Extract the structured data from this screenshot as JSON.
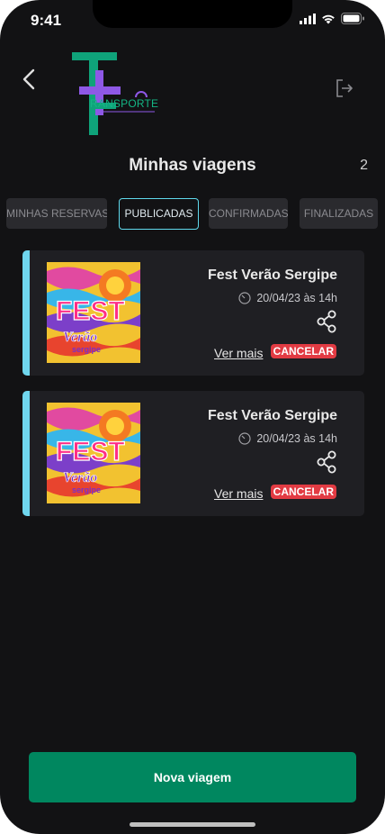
{
  "status": {
    "time": "9:41"
  },
  "header": {
    "logo_text": "RANSPORTE",
    "title": "Minhas viagens",
    "count": "2"
  },
  "tabs": [
    {
      "label": "MINHAS RESERVAS",
      "active": false
    },
    {
      "label": "PUBLICADAS",
      "active": true
    },
    {
      "label": "CONFIRMADAS",
      "active": false
    },
    {
      "label": "FINALIZADAS",
      "active": false
    }
  ],
  "trips": [
    {
      "name": "Fest Verão Sergipe",
      "date": "20/04/23 às 14h",
      "more_label": "Ver mais",
      "cancel_label": "CANCELAR",
      "poster_text": "FEST",
      "poster_sub": "Verão",
      "poster_sub2": "sergipe"
    },
    {
      "name": "Fest Verão Sergipe",
      "date": "20/04/23 às 14h",
      "more_label": "Ver mais",
      "cancel_label": "CANCELAR",
      "poster_text": "FEST",
      "poster_sub": "Verão",
      "poster_sub2": "sergipe"
    }
  ],
  "footer": {
    "primary_label": "Nova viagem"
  },
  "colors": {
    "accent": "#6fd6ee",
    "primary": "#00875f",
    "danger": "#e23b43",
    "logo_green": "#0fa37a",
    "logo_purple": "#8e58e6"
  },
  "icons": {
    "back": "chevron-left-icon",
    "logout": "logout-icon",
    "clock": "clock-icon",
    "share": "share-icon"
  }
}
